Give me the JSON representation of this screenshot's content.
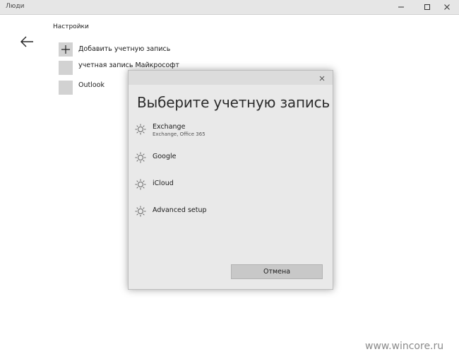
{
  "window": {
    "title": "Люди",
    "minimize_icon": "minimize-icon",
    "maximize_icon": "maximize-icon",
    "close_icon": "close-icon"
  },
  "page": {
    "breadcrumb": "Настройки",
    "back_icon": "back-arrow-icon",
    "accounts": [
      {
        "label": "Добавить учетную запись",
        "icon": "plus-icon"
      },
      {
        "label": "учетная запись Майкрософт",
        "icon": "account-tile"
      },
      {
        "label": "Outlook",
        "icon": "account-tile"
      }
    ]
  },
  "dialog": {
    "title": "Выберите учетную запись",
    "close_icon": "close-icon",
    "options": [
      {
        "name": "Exchange",
        "sub": "Exchange, Office 365",
        "icon": "gear-icon"
      },
      {
        "name": "Google",
        "icon": "gear-icon"
      },
      {
        "name": "iCloud",
        "icon": "gear-icon"
      },
      {
        "name": "Advanced setup",
        "icon": "gear-icon"
      }
    ],
    "cancel_label": "Отмена"
  },
  "watermark": "www.wincore.ru",
  "colors": {
    "dialog_bg": "#e9e9e9",
    "tile": "#d2d2d2",
    "button": "#c8c8c8"
  }
}
